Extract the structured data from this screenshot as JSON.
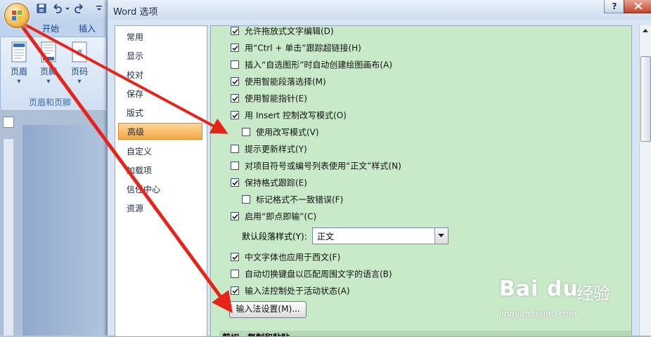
{
  "ribbon": {
    "tabs": [
      "开始",
      "插入"
    ],
    "buttons": [
      "页眉",
      "页脚",
      "页码"
    ],
    "group_label": "页眉和页脚"
  },
  "dialog": {
    "title": "Word 选项",
    "help_label": "?",
    "nav_items": [
      "常用",
      "显示",
      "校对",
      "保存",
      "版式",
      "高级",
      "自定义",
      "加载项",
      "信任中心",
      "资源"
    ],
    "selected_nav": "高级",
    "options": [
      {
        "label": "允许拖放式文字编辑(D)",
        "checked": true,
        "indent": false
      },
      {
        "label": "用“Ctrl + 单击”跟踪超链接(H)",
        "checked": true,
        "indent": false
      },
      {
        "label": "插入“自选图形”时自动创建绘图画布(A)",
        "checked": false,
        "indent": false
      },
      {
        "label": "使用智能段落选择(M)",
        "checked": true,
        "indent": false
      },
      {
        "label": "使用智能指针(E)",
        "checked": true,
        "indent": false
      },
      {
        "label": "用 Insert 控制改写模式(O)",
        "checked": true,
        "indent": false
      },
      {
        "label": "使用改写模式(V)",
        "checked": false,
        "indent": true
      },
      {
        "label": "提示更新样式(Y)",
        "checked": false,
        "indent": false
      },
      {
        "label": "对项目符号或编号列表使用“正文”样式(N)",
        "checked": false,
        "indent": false
      },
      {
        "label": "保持格式跟踪(E)",
        "checked": true,
        "indent": false
      },
      {
        "label": "标记格式不一致错误(F)",
        "checked": false,
        "indent": true
      },
      {
        "label": "启用“即点即输”(C)",
        "checked": true,
        "indent": false
      },
      {
        "label": "中文字体也应用于西文(F)",
        "checked": true,
        "indent": false
      },
      {
        "label": "自动切换键盘以匹配周围文字的语言(B)",
        "checked": false,
        "indent": false
      },
      {
        "label": "输入法控制处于活动状态(A)",
        "checked": true,
        "indent": false
      }
    ],
    "default_paragraph_label": "默认段落样式(Y):",
    "default_paragraph_value": "正文",
    "ime_settings_button": "输入法设置(M)...",
    "next_section_header": "剪切、复制和粘贴"
  },
  "watermark": {
    "logo": "Bai du",
    "text": "经验",
    "url": "jingyan.baidu.com"
  },
  "colors": {
    "content_bg": "#c8eac8",
    "selected_nav": "#f4a844",
    "arrow": "#e8231a"
  }
}
